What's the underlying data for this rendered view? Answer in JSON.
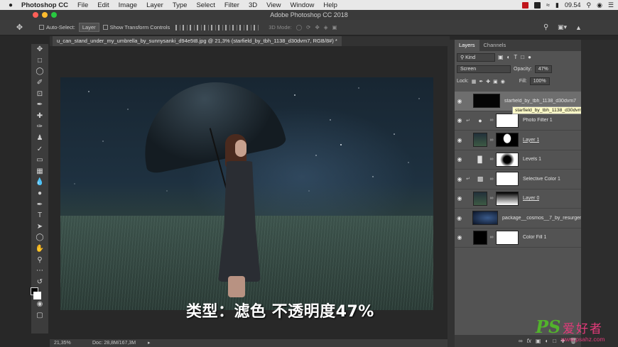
{
  "menubar": {
    "apple": "",
    "app_name": "Photoshop CC",
    "items": [
      "File",
      "Edit",
      "Image",
      "Layer",
      "Type",
      "Select",
      "Filter",
      "3D",
      "View",
      "Window",
      "Help"
    ],
    "clock": "09.54"
  },
  "window": {
    "title": "Adobe Photoshop CC 2018"
  },
  "options": {
    "auto_select_label": "Auto-Select:",
    "auto_select_value": "Layer",
    "transform_label": "Show Transform Controls",
    "mode_3d_label": "3D Mode:"
  },
  "document": {
    "tab_label": "u_can_stand_under_my_umbrella_by_sunnysanki_d94e5t8.jpg @ 21,3% (starfield_by_tbh_1138_d30dvm7, RGB/8#) *",
    "caption": "类型：滤色  不透明度47%",
    "zoom": "21,35%",
    "doc_size": "Doc: 28,8M/167,3M"
  },
  "layers_panel": {
    "tabs": [
      "Layers",
      "Channels"
    ],
    "filter_kind": "Kind",
    "blend_mode": "Screen",
    "opacity_label": "Opacity:",
    "opacity_value": "47%",
    "lock_label": "Lock:",
    "fill_label": "Fill:",
    "fill_value": "100%",
    "tooltip": "starfield_by_tbh_1138_d30dvm7",
    "layers": [
      {
        "name": "starfield_by_tbh_1138_d30dvm7",
        "selected": true
      },
      {
        "name": "Photo Filter 1"
      },
      {
        "name": "Layer 1"
      },
      {
        "name": "Levels 1"
      },
      {
        "name": "Selective Color 1"
      },
      {
        "name": "Layer 0"
      },
      {
        "name": "package__cosmos__7_by_resurger..."
      },
      {
        "name": "Color Fill 1"
      }
    ]
  },
  "watermark": {
    "logo": "PS",
    "site_name": "爱好者",
    "url": "www.psahz.com"
  },
  "colors": {
    "accent_red": "#c0141a",
    "ui_dark": "#3c3c3c",
    "panel_gray": "#535353",
    "tooltip_yellow": "#fffcc8"
  }
}
